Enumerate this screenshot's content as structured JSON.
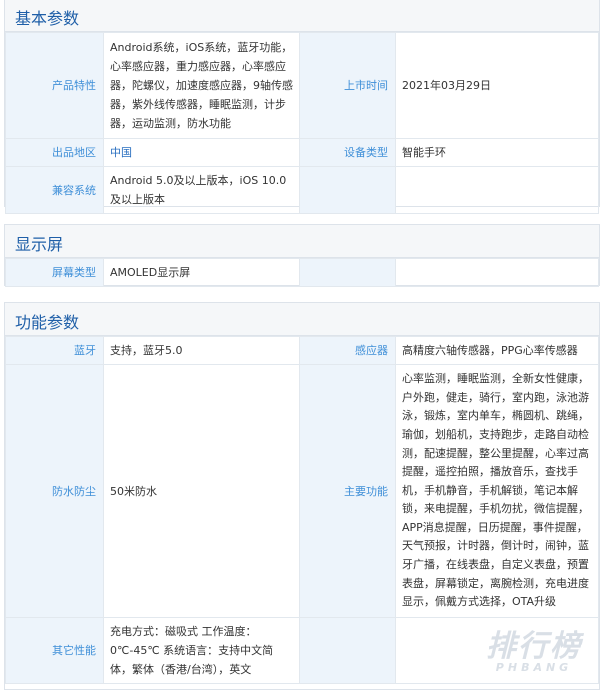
{
  "sections": {
    "basic": {
      "title": "基本参数",
      "rows": [
        {
          "label1": "产品特性",
          "value1": "Android系统，iOS系统，蓝牙功能，心率感应器，重力感应器，心率感应器，陀螺仪，加速度感应器，9轴传感器，紫外线传感器，睡眠监测，计步器，运动监测，防水功能",
          "label2": "上市时间",
          "value2": "2021年03月29日"
        },
        {
          "label1": "出品地区",
          "value1": "中国",
          "label2": "设备类型",
          "value2": "智能手环"
        },
        {
          "label1": "兼容系统",
          "value1": "Android 5.0及以上版本，iOS 10.0及以上版本",
          "label2": "",
          "value2": ""
        }
      ]
    },
    "display": {
      "title": "显示屏",
      "rows": [
        {
          "label1": "屏幕类型",
          "value1": "AMOLED显示屏",
          "label2": "",
          "value2": ""
        }
      ]
    },
    "function": {
      "title": "功能参数",
      "rows": [
        {
          "label1": "蓝牙",
          "value1": "支持，蓝牙5.0",
          "label2": "感应器",
          "value2": "高精度六轴传感器，PPG心率传感器"
        },
        {
          "label1": "防水防尘",
          "value1": "50米防水",
          "label2": "主要功能",
          "value2": "心率监测，睡眠监测，全新女性健康，户外跑，健走，骑行，室内跑，泳池游泳，锻炼，室内单车，椭圆机、跳绳，瑜伽，划船机，支持跑步，走路自动检测，配速提醒，整公里提醒，心率过高提醒，遥控拍照，播放音乐，查找手机，手机静音，手机解锁，笔记本解锁，来电提醒，手机勿扰，微信提醒，APP消息提醒，日历提醒，事件提醒，天气预报，计时器，倒计时，闹钟，蓝牙广播，在线表盘，自定义表盘，预置表盘，屏幕锁定，离腕检测，充电进度显示，佩戴方式选择，OTA升级"
        },
        {
          "label1": "其它性能",
          "value1": "充电方式：磁吸式 工作温度：0℃-45℃ 系统语言：支持中文简体，繁体（香港/台湾），英文",
          "label2": "",
          "value2": ""
        }
      ]
    }
  },
  "watermark": {
    "main": "排行榜",
    "sub": "PHBANG"
  }
}
